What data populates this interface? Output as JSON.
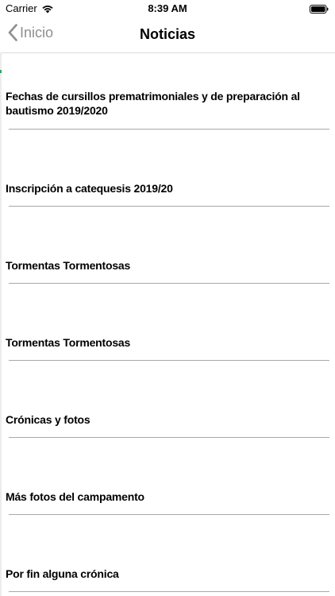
{
  "status_bar": {
    "carrier": "Carrier",
    "time": "8:39 AM",
    "icons": [
      "wifi-icon",
      "battery-icon"
    ]
  },
  "nav": {
    "back_label": "Inicio",
    "back_icon": "chevron-left-icon",
    "title": "Noticias"
  },
  "colors": {
    "back_tint": "#8e8e93",
    "divider": "#a9a9a9",
    "accent_mark": "#3aa06a"
  },
  "news": [
    {
      "title": "Fechas de cursillos prematrimoniales y de preparación al bautismo 2019/2020"
    },
    {
      "title": "Inscripción a catequesis 2019/20"
    },
    {
      "title": "Tormentas Tormentosas"
    },
    {
      "title": "Tormentas Tormentosas"
    },
    {
      "title": "Crónicas y fotos"
    },
    {
      "title": "Más fotos del campamento"
    },
    {
      "title": "Por fin alguna crónica"
    }
  ]
}
